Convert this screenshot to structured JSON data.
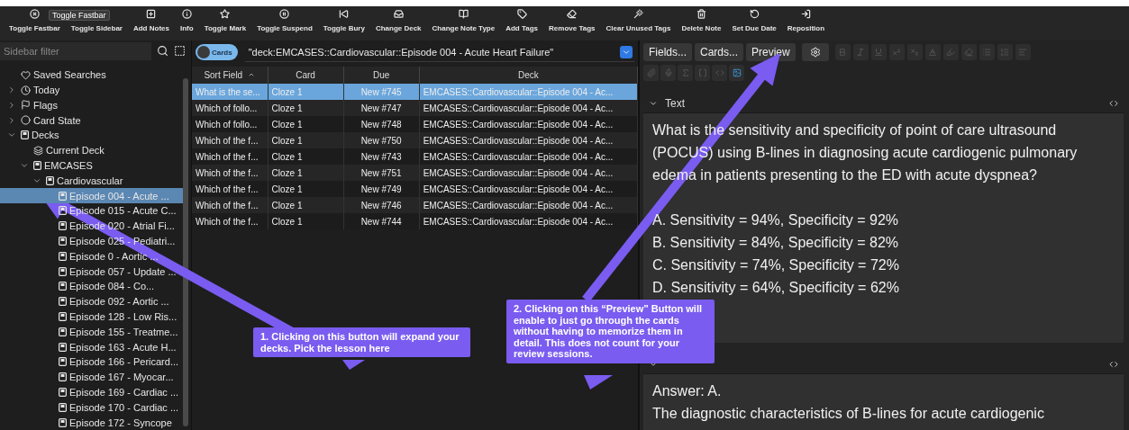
{
  "tooltip": "Toggle Fastbar",
  "toolbar": [
    {
      "label": "Toggle Fastbar"
    },
    {
      "label": "Toggle Sidebar"
    },
    {
      "label": "Add Notes"
    },
    {
      "label": "Info"
    },
    {
      "label": "Toggle Mark"
    },
    {
      "label": "Toggle Suspend"
    },
    {
      "label": "Toggle Bury"
    },
    {
      "label": "Change Deck"
    },
    {
      "label": "Change Note Type"
    },
    {
      "label": "Add Tags"
    },
    {
      "label": "Remove Tags"
    },
    {
      "label": "Clear Unused Tags"
    },
    {
      "label": "Delete Note"
    },
    {
      "label": "Set Due Date"
    },
    {
      "label": "Reposition"
    }
  ],
  "sidebar": {
    "placeholder": "Sidebar filter",
    "items": [
      {
        "label": "Saved Searches",
        "kind": "saved",
        "selected": false
      },
      {
        "label": "Today",
        "kind": "today",
        "expanded": false,
        "selected": false
      },
      {
        "label": "Flags",
        "kind": "flag",
        "expanded": false,
        "selected": false
      },
      {
        "label": "Card State",
        "kind": "state",
        "expanded": false,
        "selected": false
      },
      {
        "label": "Decks",
        "kind": "deck",
        "expanded": true,
        "selected": false,
        "children": [
          {
            "label": "Current Deck",
            "kind": "current",
            "selected": false
          },
          {
            "label": "EMCASES",
            "kind": "deck",
            "expanded": true,
            "selected": false,
            "children": [
              {
                "label": "Cardiovascular",
                "kind": "deck",
                "expanded": true,
                "selected": false,
                "children": [
                  {
                    "label": "Episode 004 - Acute ...",
                    "kind": "deck",
                    "selected": true
                  },
                  {
                    "label": "Episode 015 - Acute C...",
                    "kind": "deck",
                    "selected": false
                  },
                  {
                    "label": "Episode 020 - Atrial Fi...",
                    "kind": "deck",
                    "selected": false
                  },
                  {
                    "label": "Episode 025 - Pediatri...",
                    "kind": "deck",
                    "selected": false
                  },
                  {
                    "label": "Episode 0 - Aortic ...",
                    "kind": "deck",
                    "selected": false
                  },
                  {
                    "label": "Episode 057 - Update ...",
                    "kind": "deck",
                    "selected": false
                  },
                  {
                    "label": "Episode 084 - Co...",
                    "kind": "deck",
                    "selected": false
                  },
                  {
                    "label": "Episode 092 - Aortic ...",
                    "kind": "deck",
                    "selected": false
                  },
                  {
                    "label": "Episode 128 - Low Ris...",
                    "kind": "deck",
                    "selected": false
                  },
                  {
                    "label": "Episode 155 - Treatme...",
                    "kind": "deck",
                    "selected": false
                  },
                  {
                    "label": "Episode 163 - Acute H...",
                    "kind": "deck",
                    "selected": false
                  },
                  {
                    "label": "Episode 166 - Pericard...",
                    "kind": "deck",
                    "selected": false
                  },
                  {
                    "label": "Episode 167 - Myocar...",
                    "kind": "deck",
                    "selected": false
                  },
                  {
                    "label": "Episode 169 - Cardiac ...",
                    "kind": "deck",
                    "selected": false
                  },
                  {
                    "label": "Episode 170 - Cardiac ...",
                    "kind": "deck",
                    "selected": false
                  },
                  {
                    "label": "Episode 172 - Syncope",
                    "kind": "deck",
                    "selected": false
                  }
                ]
              }
            ]
          }
        ]
      }
    ]
  },
  "browser": {
    "mode_toggle": "Cards",
    "search": "\"deck:EMCASES::Cardiovascular::Episode 004 - Acute Heart Failure\"",
    "columns": [
      "Sort Field",
      "Card",
      "Due",
      "Deck"
    ],
    "rows": [
      {
        "cells": [
          "What is the se...",
          "Cloze 1",
          "New #745",
          "EMCASES::Cardiovascular::Episode 004 - Ac..."
        ],
        "selected": true
      },
      {
        "cells": [
          "Which of follo...",
          "Cloze 1",
          "New #747",
          "EMCASES::Cardiovascular::Episode 004 - Ac..."
        ],
        "selected": false
      },
      {
        "cells": [
          "Which of follo...",
          "Cloze 1",
          "New #748",
          "EMCASES::Cardiovascular::Episode 004 - Ac..."
        ],
        "selected": false
      },
      {
        "cells": [
          "Which of the f...",
          "Cloze 1",
          "New #750",
          "EMCASES::Cardiovascular::Episode 004 - Ac..."
        ],
        "selected": false
      },
      {
        "cells": [
          "Which of the f...",
          "Cloze 1",
          "New #743",
          "EMCASES::Cardiovascular::Episode 004 - Ac..."
        ],
        "selected": false
      },
      {
        "cells": [
          "Which of the f...",
          "Cloze 1",
          "New #751",
          "EMCASES::Cardiovascular::Episode 004 - Ac..."
        ],
        "selected": false
      },
      {
        "cells": [
          "Which of the f...",
          "Cloze 1",
          "New #749",
          "EMCASES::Cardiovascular::Episode 004 - Ac..."
        ],
        "selected": false
      },
      {
        "cells": [
          "Which of the f...",
          "Cloze 1",
          "New #746",
          "EMCASES::Cardiovascular::Episode 004 - Ac..."
        ],
        "selected": false
      },
      {
        "cells": [
          "Which of the f...",
          "Cloze 1",
          "New #744",
          "EMCASES::Cardiovascular::Episode 004 - Ac..."
        ],
        "selected": false
      }
    ]
  },
  "editor": {
    "buttons": [
      "Fields...",
      "Cards...",
      "Preview"
    ],
    "fields": [
      {
        "name": "Text",
        "paragraphs": [
          [
            "What is the sensitivity and specificity of point of care ultrasound (POCUS) using B-lines in diagnosing acute cardiogenic pulmonary edema in patients presenting to the ED with acute dyspnea?"
          ],
          [
            "A. Sensitivity = 94%, Specificity = 92%",
            "B. Sensitivity = 84%, Specificity = 82%",
            "C. Sensitivity = 74%, Specificity = 72%",
            "D. Sensitivity = 64%, Specificity = 62%"
          ]
        ]
      },
      {
        "paragraphs": [
          [
            "Answer: A.",
            "The diagnostic characteristics of B-lines for acute cardiogenic"
          ]
        ]
      }
    ]
  },
  "callouts": [
    "1. Clicking on this button will expand your decks. Pick the lesson here",
    "2. Clicking on this “Preview” Button will enable to just go through the cards without having to memorize them in detail. This does not count for your review sessions."
  ]
}
